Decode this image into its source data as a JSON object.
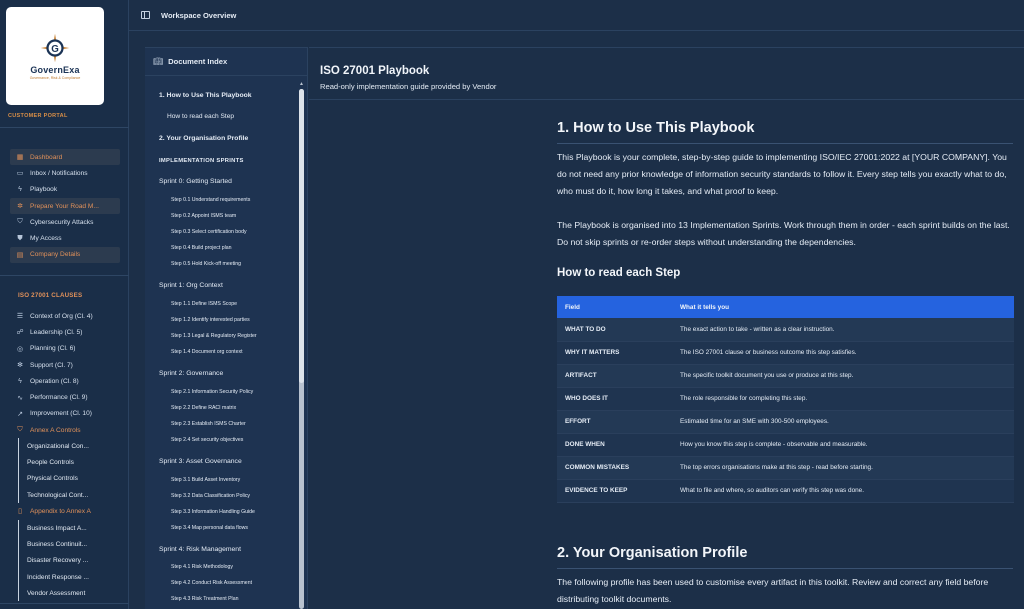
{
  "brand": {
    "name": "GovernExa",
    "tagline": "Governance, Risk & Compliance",
    "portal_label": "CUSTOMER PORTAL"
  },
  "sidebar": {
    "main_items": [
      {
        "label": "Dashboard",
        "icon": "grid-icon"
      },
      {
        "label": "Inbox / Notifications",
        "icon": "inbox-icon"
      },
      {
        "label": "Playbook",
        "icon": "bolt-icon"
      },
      {
        "label": "Prepare Your Road M...",
        "icon": "settings-icon"
      },
      {
        "label": "Cybersecurity Attacks",
        "icon": "shield-icon"
      },
      {
        "label": "My Access",
        "icon": "shield-check-icon"
      },
      {
        "label": "Company Details",
        "icon": "building-icon"
      }
    ],
    "clauses_title": "ISO 27001 CLAUSES",
    "clause_items": [
      {
        "label": "Context of Org (Cl. 4)",
        "icon": "checklist-icon"
      },
      {
        "label": "Leadership (Cl. 5)",
        "icon": "people-icon"
      },
      {
        "label": "Planning (Cl. 6)",
        "icon": "target-icon"
      },
      {
        "label": "Support (Cl. 7)",
        "icon": "gear-icon"
      },
      {
        "label": "Operation (Cl. 8)",
        "icon": "bolt-icon"
      },
      {
        "label": "Performance (Cl. 9)",
        "icon": "pulse-icon"
      },
      {
        "label": "Improvement (Cl. 10)",
        "icon": "trend-icon"
      },
      {
        "label": "Annex A Controls",
        "icon": "shield-icon"
      }
    ],
    "annex_items": [
      "Organizational Con...",
      "People Controls",
      "Physical Controls",
      "Technological Cont..."
    ],
    "appendix_label": "Appendix to Annex A",
    "appendix_items": [
      "Business Impact A...",
      "Business Continuit...",
      "Disaster Recovery ...",
      "Incident Response ...",
      "Vendor Assessment"
    ]
  },
  "topbar": {
    "title": "Workspace Overview"
  },
  "index": {
    "title": "Document Index",
    "entries": [
      {
        "text": "1. How to Use This Playbook",
        "level": "lvl1"
      },
      {
        "text": "How to read each Step",
        "level": "lvl2"
      },
      {
        "text": "2. Your Organisation Profile",
        "level": "lvl1"
      },
      {
        "text": "IMPLEMENTATION SPRINTS",
        "level": "grp"
      },
      {
        "text": "Sprint 0: Getting Started",
        "level": "lvl1n"
      },
      {
        "text": "Step 0.1 Understand requirements",
        "level": "lvl3"
      },
      {
        "text": "Step 0.2 Appoint ISMS team",
        "level": "lvl3"
      },
      {
        "text": "Step 0.3 Select certification body",
        "level": "lvl3"
      },
      {
        "text": "Step 0.4 Build project plan",
        "level": "lvl3"
      },
      {
        "text": "Step 0.5 Hold Kick-off meeting",
        "level": "lvl3"
      },
      {
        "text": "Sprint 1: Org Context",
        "level": "lvl1n"
      },
      {
        "text": "Step 1.1 Define ISMS Scope",
        "level": "lvl3"
      },
      {
        "text": "Step 1.2 Identify interested parties",
        "level": "lvl3"
      },
      {
        "text": "Step 1.3 Legal & Regulatory Register",
        "level": "lvl3"
      },
      {
        "text": "Step 1.4 Document org context",
        "level": "lvl3"
      },
      {
        "text": "Sprint 2: Governance",
        "level": "lvl1n"
      },
      {
        "text": "Step 2.1 Information Security Policy",
        "level": "lvl3"
      },
      {
        "text": "Step 2.2 Define RACI matrix",
        "level": "lvl3"
      },
      {
        "text": "Step 2.3 Establish ISMS Charter",
        "level": "lvl3"
      },
      {
        "text": "Step 2.4 Set security objectives",
        "level": "lvl3"
      },
      {
        "text": "Sprint 3: Asset Governance",
        "level": "lvl1n"
      },
      {
        "text": "Step 3.1 Build Asset Inventory",
        "level": "lvl3"
      },
      {
        "text": "Step 3.2 Data Classification Policy",
        "level": "lvl3"
      },
      {
        "text": "Step 3.3 Information Handling Guide",
        "level": "lvl3"
      },
      {
        "text": "Step 3.4 Map personal data flows",
        "level": "lvl3"
      },
      {
        "text": "Sprint 4: Risk Management",
        "level": "lvl1n"
      },
      {
        "text": "Step 4.1 Risk Methodology",
        "level": "lvl3"
      },
      {
        "text": "Step 4.2 Conduct Risk Assessment",
        "level": "lvl3"
      },
      {
        "text": "Step 4.3 Risk Treatment Plan",
        "level": "lvl3"
      }
    ]
  },
  "doc": {
    "title": "ISO 27001 Playbook",
    "subtitle": "Read-only implementation guide provided by Vendor",
    "section1_title": "1. How to Use This Playbook",
    "section1_p1": "This Playbook is your complete, step-by-step guide to implementing ISO/IEC 27001:2022 at [YOUR COMPANY]. You do not need any prior knowledge of information security standards to follow it. Every step tells you exactly what to do, who must do it, how long it takes, and what proof to keep.",
    "section1_p2": "The Playbook is organised into 13 Implementation Sprints. Work through them in order - each sprint builds on the last. Do not skip sprints or re-order steps without understanding the dependencies.",
    "subsection_title": "How to read each Step",
    "table": {
      "headers": [
        "Field",
        "What it tells you"
      ],
      "rows": [
        [
          "WHAT TO DO",
          "The exact action to take - written as a clear instruction."
        ],
        [
          "WHY IT MATTERS",
          "The ISO 27001 clause or business outcome this step satisfies."
        ],
        [
          "ARTIFACT",
          "The specific toolkit document you use or produce at this step."
        ],
        [
          "WHO DOES IT",
          "The role responsible for completing this step."
        ],
        [
          "EFFORT",
          "Estimated time for an SME with 300-500 employees."
        ],
        [
          "DONE WHEN",
          "How you know this step is complete - observable and measurable."
        ],
        [
          "COMMON MISTAKES",
          "The top errors organisations make at this step - read before starting."
        ],
        [
          "EVIDENCE TO KEEP",
          "What to file and where, so auditors can verify this step was done."
        ]
      ]
    },
    "section2_title": "2. Your Organisation Profile",
    "section2_p1": "The following profile has been used to customise every artifact in this toolkit. Review and correct any field before distributing toolkit documents."
  }
}
